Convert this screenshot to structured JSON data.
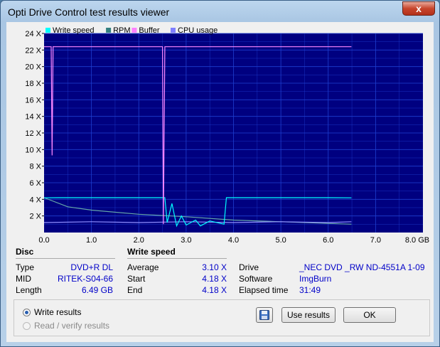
{
  "window": {
    "title": "Opti Drive Control test results viewer",
    "close_glyph": "x"
  },
  "chart": {
    "legend": [
      {
        "label": "Write speed",
        "color": "#00ffff"
      },
      {
        "label": "RPM",
        "color": "#338080"
      },
      {
        "label": "Buffer",
        "color": "#ff80ff"
      },
      {
        "label": "CPU usage",
        "color": "#8080ff"
      }
    ],
    "y_ticks": [
      "2 X",
      "4 X",
      "6 X",
      "8 X",
      "10 X",
      "12 X",
      "14 X",
      "16 X",
      "18 X",
      "20 X",
      "22 X",
      "24 X"
    ],
    "x_ticks": [
      "0.0",
      "1.0",
      "2.0",
      "3.0",
      "4.0",
      "5.0",
      "6.0",
      "7.0",
      "8.0 GB"
    ],
    "colors": {
      "plot_bg": "#000080",
      "grid": "#1e3fd0",
      "speed": "#00ffff",
      "rpm": "#66a8a8",
      "buffer": "#ff88ff",
      "cpu": "#9090ff"
    }
  },
  "chart_data": {
    "type": "line",
    "xlabel": "",
    "ylabel": "",
    "xlim": [
      0,
      8.0
    ],
    "ylim": [
      0,
      24
    ],
    "x_unit": "GB",
    "y_unit": "X",
    "series": [
      {
        "name": "Write speed",
        "points": [
          [
            0.0,
            4.18
          ],
          [
            0.3,
            4.2
          ],
          [
            1.0,
            4.2
          ],
          [
            2.0,
            4.2
          ],
          [
            2.55,
            4.2
          ],
          [
            2.6,
            1.2
          ],
          [
            2.7,
            3.5
          ],
          [
            2.8,
            0.8
          ],
          [
            2.9,
            2.0
          ],
          [
            3.0,
            0.9
          ],
          [
            3.2,
            1.5
          ],
          [
            3.3,
            0.8
          ],
          [
            3.5,
            1.4
          ],
          [
            3.8,
            1.0
          ],
          [
            3.85,
            4.2
          ],
          [
            5.0,
            4.2
          ],
          [
            6.0,
            4.2
          ],
          [
            6.49,
            4.18
          ]
        ]
      },
      {
        "name": "RPM",
        "points": [
          [
            0.0,
            4.2
          ],
          [
            0.5,
            3.1
          ],
          [
            1.0,
            2.7
          ],
          [
            2.0,
            2.2
          ],
          [
            3.0,
            1.9
          ],
          [
            4.0,
            1.5
          ],
          [
            5.0,
            1.3
          ],
          [
            6.0,
            1.1
          ],
          [
            6.49,
            1.0
          ]
        ]
      },
      {
        "name": "Buffer",
        "points": [
          [
            0.0,
            22.4
          ],
          [
            0.15,
            22.4
          ],
          [
            0.17,
            9.3
          ],
          [
            0.19,
            22.4
          ],
          [
            0.5,
            22.4
          ],
          [
            1.0,
            22.4
          ],
          [
            2.5,
            22.4
          ],
          [
            2.52,
            1.0
          ],
          [
            2.55,
            22.4
          ],
          [
            3.0,
            22.4
          ],
          [
            3.2,
            22.4
          ],
          [
            3.8,
            22.4
          ],
          [
            5.0,
            22.4
          ],
          [
            6.0,
            22.4
          ],
          [
            6.49,
            22.4
          ]
        ]
      },
      {
        "name": "CPU usage",
        "points": [
          [
            0.0,
            1.2
          ],
          [
            1.0,
            1.3
          ],
          [
            2.0,
            1.2
          ],
          [
            3.0,
            1.3
          ],
          [
            4.0,
            1.2
          ],
          [
            5.0,
            1.3
          ],
          [
            6.0,
            1.2
          ],
          [
            6.49,
            1.3
          ]
        ]
      }
    ]
  },
  "disc": {
    "title": "Disc",
    "rows": [
      {
        "label": "Type",
        "value": "DVD+R DL"
      },
      {
        "label": "MID",
        "value": "RITEK-S04-66"
      },
      {
        "label": "Length",
        "value": "6.49 GB"
      }
    ]
  },
  "write_speed": {
    "title": "Write speed",
    "rows": [
      {
        "label": "Average",
        "value": "3.10 X"
      },
      {
        "label": "Start",
        "value": "4.18 X"
      },
      {
        "label": "End",
        "value": "4.18 X"
      }
    ]
  },
  "drive_info": {
    "rows": [
      {
        "label": "Drive",
        "value": "_NEC DVD _RW ND-4551A 1-09"
      },
      {
        "label": "Software",
        "value": "ImgBurn"
      },
      {
        "label": "Elapsed time",
        "value": "31:49"
      }
    ]
  },
  "options": {
    "write_results": "Write results",
    "read_verify_results": "Read / verify results"
  },
  "buttons": {
    "use_results": "Use results",
    "ok": "OK"
  }
}
